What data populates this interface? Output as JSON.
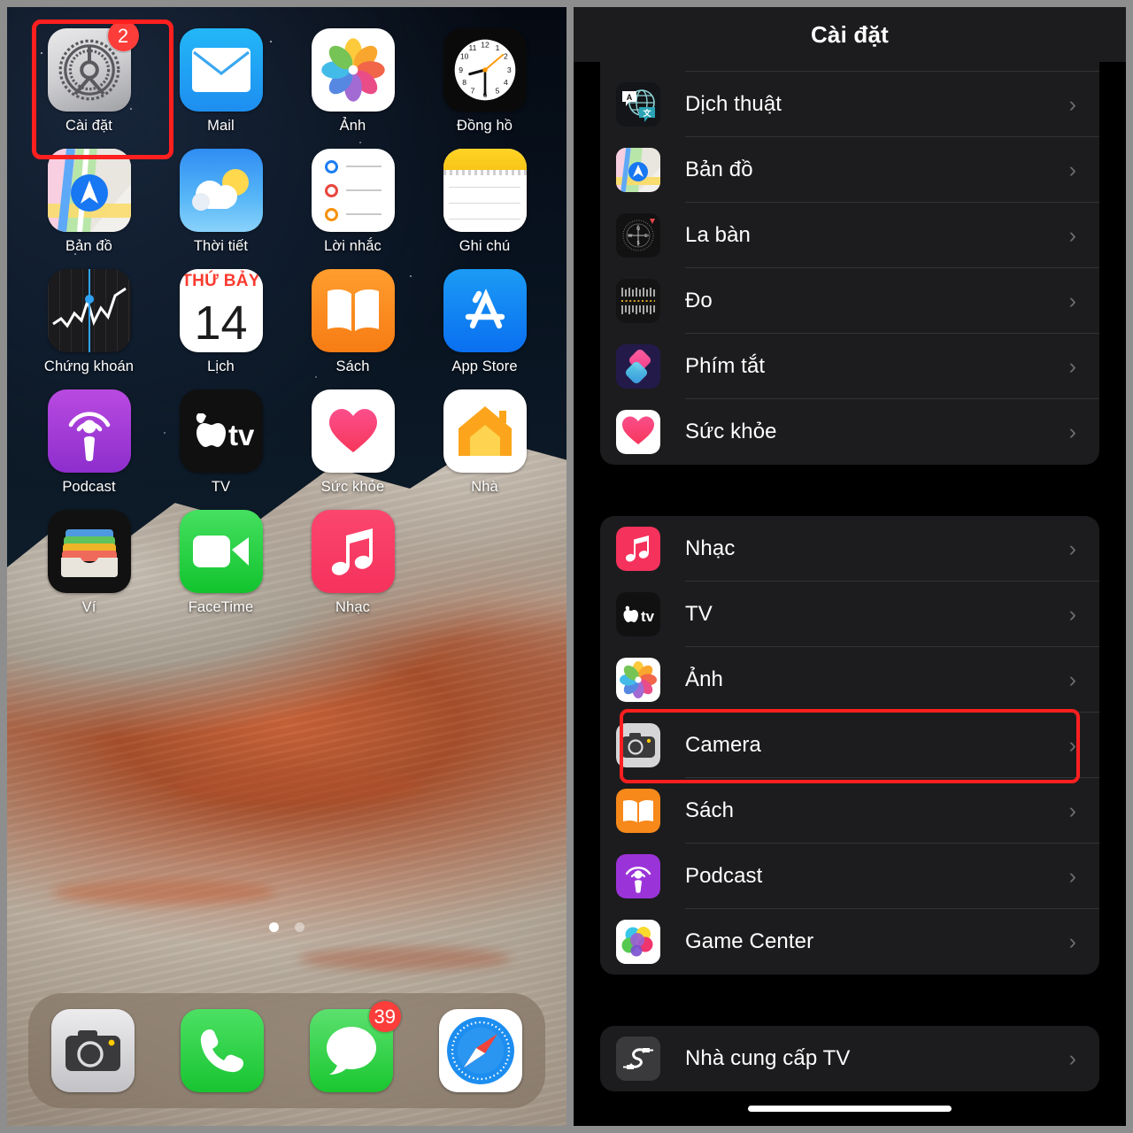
{
  "left_phone": {
    "name": "iphone-home-screen",
    "highlighted_app": "Cài đặt",
    "page_indicator": {
      "total": 2,
      "active": 1
    },
    "rows": [
      [
        {
          "label": "Cài đặt",
          "icon": "settings-gear-icon",
          "badge": "2"
        },
        {
          "label": "Mail",
          "icon": "mail-envelope-icon",
          "badge": ""
        },
        {
          "label": "Ảnh",
          "icon": "photos-flower-icon",
          "badge": ""
        },
        {
          "label": "Đồng hồ",
          "icon": "clock-icon",
          "badge": ""
        }
      ],
      [
        {
          "label": "Bản đồ",
          "icon": "maps-icon",
          "badge": ""
        },
        {
          "label": "Thời tiết",
          "icon": "weather-cloud-sun-icon",
          "badge": ""
        },
        {
          "label": "Lời nhắc",
          "icon": "reminders-icon",
          "badge": ""
        },
        {
          "label": "Ghi chú",
          "icon": "notes-icon",
          "badge": ""
        }
      ],
      [
        {
          "label": "Chứng khoán",
          "icon": "stocks-chart-icon",
          "badge": ""
        },
        {
          "label": "Lịch",
          "icon": "calendar-icon",
          "badge": ""
        },
        {
          "label": "Sách",
          "icon": "books-open-book-icon",
          "badge": ""
        },
        {
          "label": "App Store",
          "icon": "app-store-icon",
          "badge": ""
        }
      ],
      [
        {
          "label": "Podcast",
          "icon": "podcast-icon",
          "badge": ""
        },
        {
          "label": "TV",
          "icon": "apple-tv-icon",
          "badge": ""
        },
        {
          "label": "Sức khỏe",
          "icon": "health-heart-icon",
          "badge": ""
        },
        {
          "label": "Nhà",
          "icon": "home-house-icon",
          "badge": ""
        }
      ],
      [
        {
          "label": "Ví",
          "icon": "wallet-icon",
          "badge": ""
        },
        {
          "label": "FaceTime",
          "icon": "facetime-video-icon",
          "badge": ""
        },
        {
          "label": "Nhạc",
          "icon": "music-note-icon",
          "badge": ""
        }
      ]
    ],
    "calendar_icon": {
      "weekday": "THỨ BẢY",
      "day": "14"
    },
    "dock": [
      {
        "label": "Camera",
        "icon": "camera-icon",
        "badge": ""
      },
      {
        "label": "Điện thoại",
        "icon": "phone-handset-icon",
        "badge": ""
      },
      {
        "label": "Tin nhắn",
        "icon": "messages-bubble-icon",
        "badge": "39"
      },
      {
        "label": "Safari",
        "icon": "safari-compass-icon",
        "badge": ""
      }
    ]
  },
  "right_phone": {
    "name": "ios-settings-app",
    "nav": {
      "title": "Cài đặt"
    },
    "groups": [
      {
        "id": "apps-group-1",
        "items": [
          {
            "label": "Dịch thuật",
            "icon": "translate-icon",
            "chevron": "›"
          },
          {
            "label": "Bản đồ",
            "icon": "maps-icon",
            "chevron": "›"
          },
          {
            "label": "La bàn",
            "icon": "compass-icon",
            "chevron": "›"
          },
          {
            "label": "Đo",
            "icon": "measure-ruler-icon",
            "chevron": "›"
          },
          {
            "label": "Phím tắt",
            "icon": "shortcuts-icon",
            "chevron": "›"
          },
          {
            "label": "Sức khỏe",
            "icon": "health-heart-icon",
            "chevron": "›"
          }
        ]
      },
      {
        "id": "apps-group-2",
        "items": [
          {
            "label": "Nhạc",
            "icon": "music-note-icon",
            "chevron": "›"
          },
          {
            "label": "TV",
            "icon": "apple-tv-icon",
            "chevron": "›"
          },
          {
            "label": "Ảnh",
            "icon": "photos-flower-icon",
            "chevron": "›"
          },
          {
            "label": "Camera",
            "icon": "camera-icon",
            "chevron": "›"
          },
          {
            "label": "Sách",
            "icon": "books-open-book-icon",
            "chevron": "›"
          },
          {
            "label": "Podcast",
            "icon": "podcast-icon",
            "chevron": "›"
          },
          {
            "label": "Game Center",
            "icon": "game-center-icon",
            "chevron": "›"
          }
        ]
      },
      {
        "id": "apps-group-3",
        "items": [
          {
            "label": "Nhà cung cấp TV",
            "icon": "tv-provider-icon",
            "chevron": "›"
          }
        ]
      }
    ],
    "highlighted_row": "Camera"
  },
  "colors": {
    "highlight_red": "#ff1f1f",
    "badge_red": "#fc3d39",
    "card_bg": "#1c1c1e",
    "page_bg": "#000000",
    "chevron_gray": "#6d6d72",
    "separator": "#333336"
  }
}
